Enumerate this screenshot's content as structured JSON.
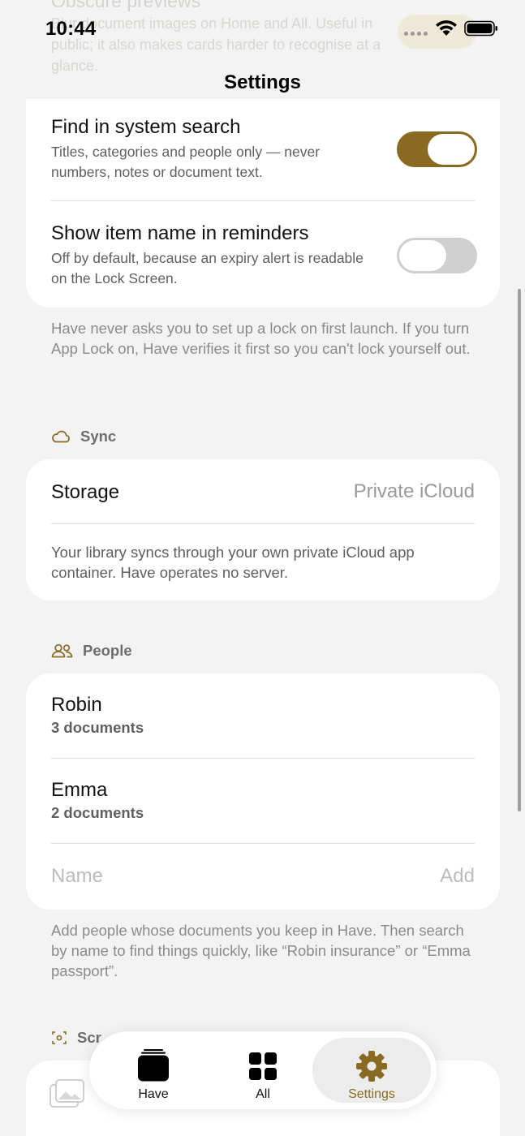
{
  "status": {
    "time": "10:44"
  },
  "header": {
    "title": "Settings"
  },
  "background_ghost": {
    "title": "Obscure previews",
    "desc": "Blur document images on Home and All. Useful in public; it also makes cards harder to recognise at a glance."
  },
  "privacy": {
    "system_search": {
      "title": "Find in system search",
      "desc": "Titles, categories and people only — never numbers, notes or document text.",
      "enabled": true
    },
    "reminders": {
      "title": "Show item name in reminders",
      "desc": "Off by default, because an expiry alert is readable on the Lock Screen.",
      "enabled": false
    },
    "footnote": "Have never asks you to set up a lock on first launch. If you turn App Lock on, Have verifies it first so you can't lock yourself out."
  },
  "sync": {
    "header": "Sync",
    "storage_label": "Storage",
    "storage_value": "Private iCloud",
    "desc": "Your library syncs through your own private iCloud app container. Have operates no server."
  },
  "people": {
    "header": "People",
    "items": [
      {
        "name": "Robin",
        "count": "3 documents"
      },
      {
        "name": "Emma",
        "count": "2 documents"
      }
    ],
    "name_placeholder": "Name",
    "add_label": "Add",
    "footnote": "Add people whose documents you keep in Have. Then search by name to find things quickly, like “Robin insurance” or “Emma passport”."
  },
  "next_section": {
    "header": "Scr"
  },
  "tabs": [
    {
      "label": "Have",
      "icon": "stack-icon"
    },
    {
      "label": "All",
      "icon": "grid-icon"
    },
    {
      "label": "Settings",
      "icon": "gear-icon",
      "active": true
    }
  ],
  "colors": {
    "accent": "#8a6a22",
    "background": "#f3f3f3",
    "card": "#ffffff"
  }
}
